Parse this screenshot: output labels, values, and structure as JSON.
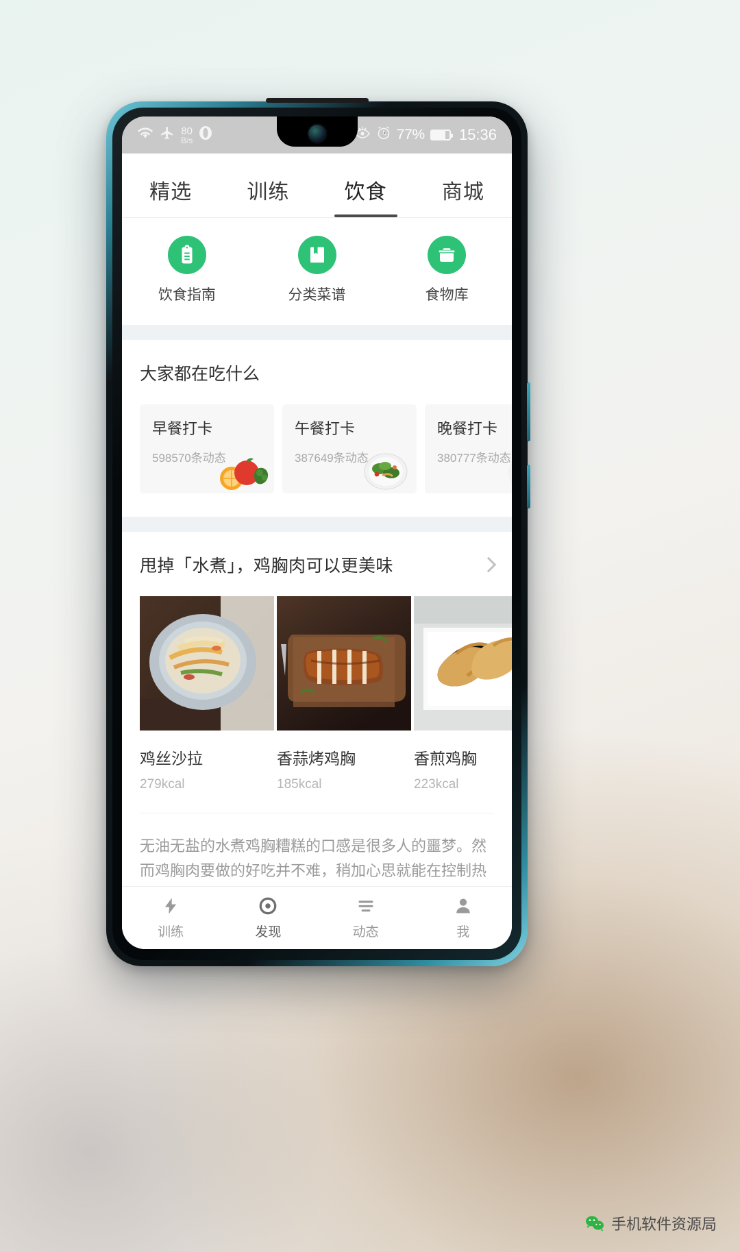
{
  "status_bar": {
    "wifi_icon": "wifi-icon",
    "airplane_icon": "airplane-mode-icon",
    "net_speed_value": "80",
    "net_speed_unit": "B/s",
    "opera_icon": "opera-icon",
    "eye_icon": "eye-care-icon",
    "alarm_icon": "alarm-clock-icon",
    "battery_percent": "77%",
    "battery_level": 77,
    "time": "15:36"
  },
  "tabs": [
    {
      "label": "精选",
      "active": false
    },
    {
      "label": "训练",
      "active": false
    },
    {
      "label": "饮食",
      "active": true
    },
    {
      "label": "商城",
      "active": false
    }
  ],
  "quick_actions": [
    {
      "label": "饮食指南",
      "icon": "clipboard-icon"
    },
    {
      "label": "分类菜谱",
      "icon": "book-icon"
    },
    {
      "label": "食物库",
      "icon": "food-container-icon"
    }
  ],
  "eating_section": {
    "title": "大家都在吃什么",
    "cards": [
      {
        "title": "早餐打卡",
        "count": "598570条动态",
        "thumb": "fruit-vegetable-thumb"
      },
      {
        "title": "午餐打卡",
        "count": "387649条动态",
        "thumb": "salad-bowl-thumb"
      },
      {
        "title": "晚餐打卡",
        "count": "380777条动态",
        "thumb": "dinner-thumb"
      }
    ]
  },
  "recipe_section": {
    "title": "甩掉「水煮」，鸡胸肉可以更美味",
    "chevron_icon": "chevron-right-icon",
    "dishes": [
      {
        "name": "鸡丝沙拉",
        "kcal": "279kcal",
        "image": "shredded-chicken-salad-photo"
      },
      {
        "name": "香蒜烤鸡胸",
        "kcal": "185kcal",
        "image": "garlic-roast-chicken-breast-photo"
      },
      {
        "name": "香煎鸡胸",
        "kcal": "223kcal",
        "image": "pan-fried-chicken-breast-photo"
      }
    ],
    "description": "无油无盐的水煮鸡胸糟糕的口感是很多人的噩梦。然而鸡胸肉要做的好吃并不难，稍加心思就能在控制热量的情况下，让鸡胸肉更美味。"
  },
  "bottom_nav": [
    {
      "label": "训练",
      "icon": "lightning-icon",
      "active": false
    },
    {
      "label": "发现",
      "icon": "compass-circle-icon",
      "active": true
    },
    {
      "label": "动态",
      "icon": "feed-lines-icon",
      "active": false
    },
    {
      "label": "我",
      "icon": "person-icon",
      "active": false
    }
  ],
  "watermark": {
    "text": "手机软件资源局",
    "logo": "wechat-logo-icon"
  },
  "colors": {
    "accent_green": "#2ec277",
    "tab_active_underline": "#4a4a4a",
    "status_bar_bg": "#c9c9c9"
  }
}
